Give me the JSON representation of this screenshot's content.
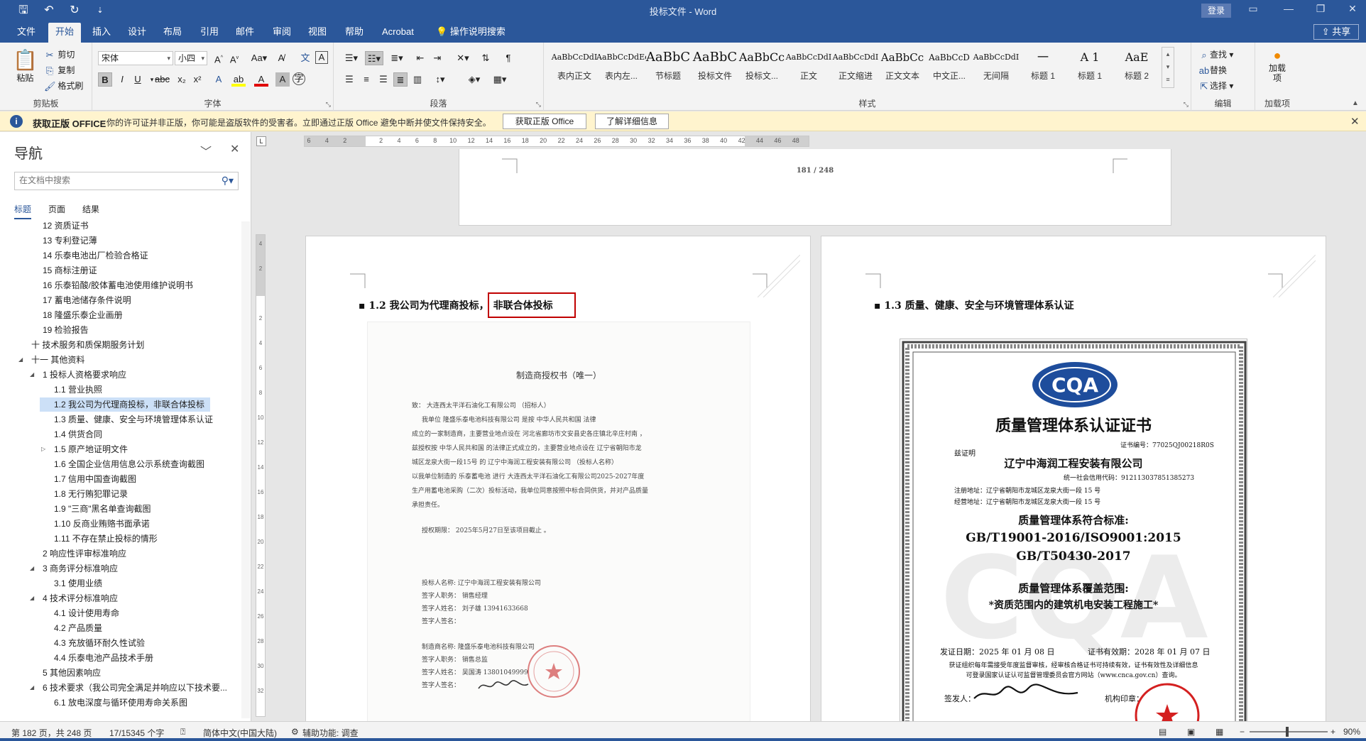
{
  "window": {
    "title": "投标文件  -  Word",
    "login_label": "登录",
    "controls": [
      "▭",
      "—",
      "❐",
      "✕"
    ]
  },
  "ribbon_tabs": [
    "文件",
    "开始",
    "插入",
    "设计",
    "布局",
    "引用",
    "邮件",
    "审阅",
    "视图",
    "帮助",
    "Acrobat",
    "操作说明搜索"
  ],
  "share_label": "共享",
  "clipboard": {
    "paste": "粘贴",
    "cut": "剪切",
    "copy": "复制",
    "format_painter": "格式刷",
    "label": "剪贴板"
  },
  "font": {
    "name": "宋体",
    "size": "小四",
    "label": "字体"
  },
  "paragraph": {
    "label": "段落"
  },
  "styles": {
    "label": "样式",
    "items": [
      {
        "preview": "AaBbCcDdI",
        "name": "表内正文",
        "size": 11
      },
      {
        "preview": "AaBbCcDdEe",
        "name": "表内左...",
        "size": 11
      },
      {
        "preview": "AaBbC",
        "name": "节标题",
        "size": 18
      },
      {
        "preview": "AaBbC",
        "name": "投标文件",
        "size": 18
      },
      {
        "preview": "AaBbCc",
        "name": "投标文...",
        "size": 16
      },
      {
        "preview": "AaBbCcDdI",
        "name": "正文",
        "size": 11
      },
      {
        "preview": "AaBbCcDdI",
        "name": "正文缩进",
        "size": 11
      },
      {
        "preview": "AaBbCc",
        "name": "正文文本",
        "size": 15
      },
      {
        "preview": "AaBbCcD",
        "name": "中文正...",
        "size": 12
      },
      {
        "preview": "AaBbCcDdI",
        "name": "无间隔",
        "size": 11
      },
      {
        "preview": "一",
        "name": "标题 1",
        "size": 16
      },
      {
        "preview": "A  1",
        "name": "标题 1",
        "size": 16
      },
      {
        "preview": "AaE",
        "name": "标题 2",
        "size": 16
      }
    ]
  },
  "editing": {
    "find": "查找",
    "replace": "替换",
    "select": "选择",
    "label": "编辑"
  },
  "addins": {
    "load": "加载项",
    "label": "加载项"
  },
  "infobar": {
    "title": "获取正版 OFFICE",
    "message": "你的许可证并非正版，你可能是盗版软件的受害者。立即通过正版 Office 避免中断并使文件保持安全。",
    "btn_get": "获取正版 Office",
    "btn_more": "了解详细信息"
  },
  "nav": {
    "title": "导航",
    "search_placeholder": "在文档中搜索",
    "tabs": [
      "标题",
      "页面",
      "结果"
    ],
    "items": [
      {
        "text": "12 资质证书",
        "indent": 2,
        "tw": ""
      },
      {
        "text": "13 专利登记薄",
        "indent": 2,
        "tw": ""
      },
      {
        "text": "14 乐泰电池出厂检验合格证",
        "indent": 2,
        "tw": ""
      },
      {
        "text": "15 商标注册证",
        "indent": 2,
        "tw": ""
      },
      {
        "text": "16 乐泰铅酸/胶体蓄电池使用维护说明书",
        "indent": 2,
        "tw": ""
      },
      {
        "text": "17 蓄电池储存条件说明",
        "indent": 2,
        "tw": ""
      },
      {
        "text": "18 隆盛乐泰企业画册",
        "indent": 2,
        "tw": ""
      },
      {
        "text": "19 检验报告",
        "indent": 2,
        "tw": ""
      },
      {
        "text": "十 技术服务和质保期服务计划",
        "indent": 1,
        "tw": ""
      },
      {
        "text": "十一 其他资料",
        "indent": 1,
        "tw": "◢"
      },
      {
        "text": "1 投标人资格要求响应",
        "indent": 2,
        "tw": "◢"
      },
      {
        "text": "1.1 营业执照",
        "indent": 3,
        "tw": ""
      },
      {
        "text": "1.2 我公司为代理商投标，非联合体投标",
        "indent": 3,
        "tw": "",
        "selected": true
      },
      {
        "text": "1.3 质量、健康、安全与环境管理体系认证",
        "indent": 3,
        "tw": ""
      },
      {
        "text": "1.4 供货合同",
        "indent": 3,
        "tw": ""
      },
      {
        "text": "1.5 原产地证明文件",
        "indent": 3,
        "tw": "▷"
      },
      {
        "text": "1.6 全国企业信用信息公示系统查询截图",
        "indent": 3,
        "tw": ""
      },
      {
        "text": "1.7 信用中国查询截图",
        "indent": 3,
        "tw": ""
      },
      {
        "text": "1.8 无行贿犯罪记录",
        "indent": 3,
        "tw": ""
      },
      {
        "text": "1.9 \"三商\"黑名单查询截图",
        "indent": 3,
        "tw": ""
      },
      {
        "text": "1.10 反商业贿赂书面承诺",
        "indent": 3,
        "tw": ""
      },
      {
        "text": "1.11 不存在禁止投标的情形",
        "indent": 3,
        "tw": ""
      },
      {
        "text": "2 响应性评审标准响应",
        "indent": 2,
        "tw": ""
      },
      {
        "text": "3 商务评分标准响应",
        "indent": 2,
        "tw": "◢"
      },
      {
        "text": "3.1 使用业绩",
        "indent": 3,
        "tw": ""
      },
      {
        "text": "4 技术评分标准响应",
        "indent": 2,
        "tw": "◢"
      },
      {
        "text": "4.1 设计使用寿命",
        "indent": 3,
        "tw": ""
      },
      {
        "text": "4.2 产品质量",
        "indent": 3,
        "tw": ""
      },
      {
        "text": "4.3 充放循环耐久性试验",
        "indent": 3,
        "tw": ""
      },
      {
        "text": "4.4 乐泰电池产品技术手册",
        "indent": 3,
        "tw": ""
      },
      {
        "text": "5 其他因素响应",
        "indent": 2,
        "tw": ""
      },
      {
        "text": "6 技术要求（我公司完全满足并响应以下技术要...",
        "indent": 2,
        "tw": "◢"
      },
      {
        "text": "6.1 放电深度与循环使用寿命关系图",
        "indent": 3,
        "tw": ""
      }
    ]
  },
  "ruler_h": [
    "6",
    "4",
    "2",
    "",
    "2",
    "4",
    "6",
    "8",
    "10",
    "12",
    "14",
    "16",
    "18",
    "20",
    "22",
    "24",
    "26",
    "28",
    "30",
    "32",
    "34",
    "36",
    "38",
    "40",
    "42",
    "44",
    "46",
    "48"
  ],
  "ruler_v": [
    "4",
    "2",
    "",
    "2",
    "4",
    "6",
    "8",
    "10",
    "12",
    "14",
    "16",
    "18",
    "20",
    "22",
    "24",
    "26",
    "28",
    "30",
    "32"
  ],
  "doc": {
    "page_number": "181 / 248",
    "left_heading": "1.2 我公司为代理商投标，",
    "left_heading_box": "非联合体投标",
    "right_heading": "1.3 质量、健康、安全与环境管理体系认证",
    "scan": {
      "title": "制造商授权书（唯一）",
      "lines": [
        "致：  大连西太平洋石油化工有限公司  （招标人）",
        "我单位  隆盛乐泰电池科技有限公司  是按  中华人民共和国  法律",
        "成立的一家制造商，主要营业地点设在  河北省廊坊市文安县史各庄镇北辛庄村南  ，",
        "兹授权按  中华人民共和国  的法律正式成立的，主要营业地点设在  辽宁省朝阳市龙",
        "城区龙泉大街一段15号  的  辽宁中海润工程安装有限公司  （投标人名称）",
        "以我单位制造的  乐泰蓄电池  进行  大连西太平洋石油化工有限公司2025-2027年度",
        "生产用蓄电池采购（二次）投标活动，我单位同意按照中标合同供货，并对产品质量",
        "承担责任。",
        "授权期限：  2025年5月27日至该项目截止  。",
        "投标人名称: 辽宁中海润工程安装有限公司",
        "签字人职务：    销售经理",
        "签字人姓名：    刘子雄 13941633668",
        "签字人签名：",
        "制造商名称: 隆盛乐泰电池科技有限公司",
        "签字人职务：    销售总监",
        "签字人姓名：    吴国涛 13801049999",
        "签字人签名："
      ]
    },
    "cert": {
      "logo": "CQA",
      "title": "质量管理体系认证证书",
      "cert_no": "证书编号：77025QJ00218R0S",
      "prove": "兹证明",
      "company": "辽宁中海润工程安装有限公司",
      "credit_code": "统一社会信用代码：912113037851385273",
      "reg_addr": "注册地址：辽宁省朝阳市龙城区龙泉大街一段 15 号",
      "op_addr": "经营地址：辽宁省朝阳市龙城区龙泉大街一段 15 号",
      "std_title": "质量管理体系符合标准:",
      "std1": "GB/T19001-2016/ISO9001:2015",
      "std2": "GB/T50430-2017",
      "scope_title": "质量管理体系覆盖范围:",
      "scope": "*资质范围内的建筑机电安装工程施工*",
      "issue": "发证日期：2025 年 01 月 08 日",
      "valid": "证书有效期：2028 年 01 月 07 日",
      "note1": "获证组织每年需接受年度监督审核，经审核合格证书可持续有效，证书有效性及详细信息",
      "note2": "可登录国家认证认可监督管理委员会官方网站（www.cnca.gov.cn）查询。",
      "signer": "签发人：",
      "seal": "机构印章："
    }
  },
  "status": {
    "page": "第 182 页，共 248 页",
    "words": "17/15345 个字",
    "lang": "简体中文(中国大陆)",
    "accessibility": "辅助功能: 调查",
    "zoom": "90%",
    "zoom_fraction": 0.48
  },
  "colors": {
    "brand": "#2b579a",
    "highlight_box": "#c00000",
    "nav_selected": "#cce0f7",
    "infobar": "#fff4ce"
  }
}
